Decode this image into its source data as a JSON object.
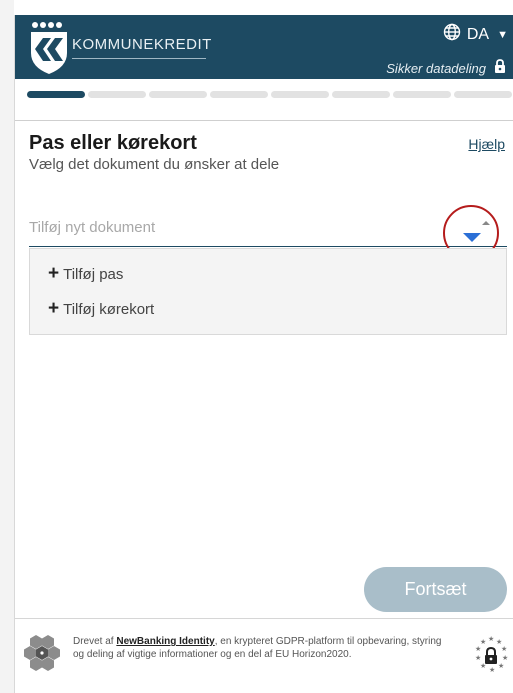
{
  "header": {
    "brand": "KOMMUNEKREDIT",
    "language": "DA",
    "secure_label": "Sikker datadeling",
    "bg_color": "#1d4a62"
  },
  "progress": {
    "total_steps": 8,
    "current_step": 1
  },
  "main": {
    "title": "Pas eller kørekort",
    "subtitle": "Vælg det dokument du ønsker at dele",
    "help_label": "Hjælp",
    "input_placeholder": "Tilføj nyt dokument",
    "dropdown_items": [
      {
        "label": "Tilføj pas"
      },
      {
        "label": "Tilføj kørekort"
      }
    ],
    "continue_label": "Fortsæt"
  },
  "footer": {
    "prefix": "Drevet af ",
    "link": "NewBanking Identity",
    "text": ", en krypteret GDPR-platform til opbevaring, styring og deling af vigtige informationer og en del af EU Horizon2020."
  },
  "icons": {
    "globe": "globe-icon",
    "caret": "caret-down-icon",
    "lock": "lock-icon",
    "toggle": "dropdown-toggle-icon",
    "plus": "plus-icon",
    "eu": "eu-lock-icon"
  }
}
